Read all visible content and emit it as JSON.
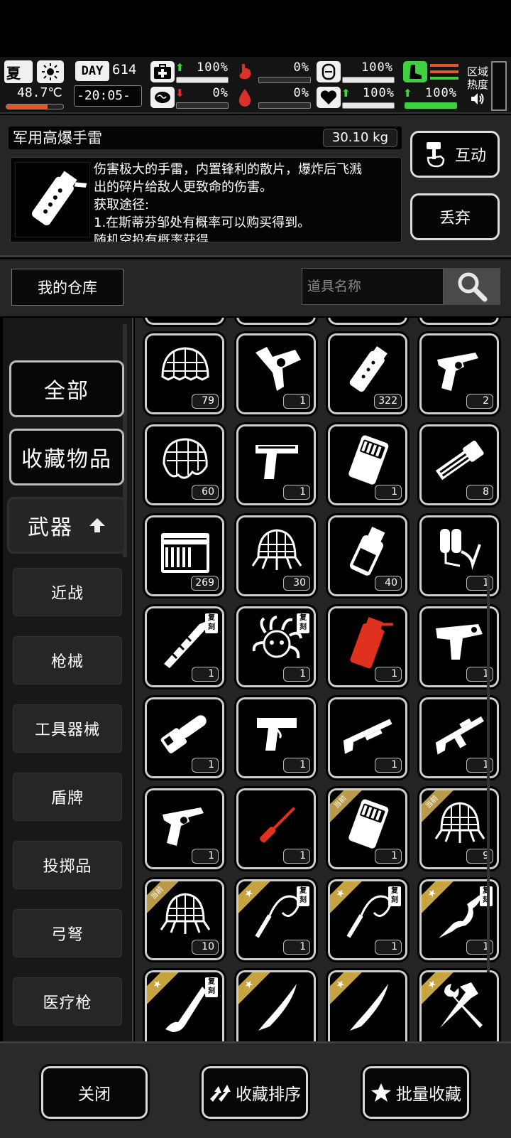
{
  "status": {
    "season": "夏",
    "temperature": "48.7℃",
    "day_label": "DAY",
    "day": "614",
    "time": "-20:05-",
    "health_pct": "100%",
    "hunger_pct": "0%",
    "stamina_pct": "100%",
    "infection_pct": "0%",
    "thirst_pct": "0%",
    "mood_pct": "100%",
    "speed_pct": "100%",
    "area_label": "区域",
    "heat_label": "热度",
    "colors": {
      "up_arrow": "#3fd13f",
      "down_arrow": "#e03030",
      "hunger_icon": "#d8322b"
    }
  },
  "item": {
    "name": "军用高爆手雷",
    "weight": "30.10 kg",
    "description_lines": [
      "伤害极大的手雷，内置锋利的散片，爆炸后飞溅",
      "出的碎片给敌人更致命的伤害。",
      "获取途径:",
      "1.在斯蒂芬邹处有概率可以购买得到。",
      "随机空投有概率获得"
    ],
    "interact_label": "互动",
    "discard_label": "丢弃"
  },
  "warehouse": {
    "title": "我的仓库",
    "search_placeholder": "道具名称"
  },
  "sidebar": {
    "categories": [
      {
        "label": "全部"
      },
      {
        "label": "收藏物品"
      },
      {
        "label": "武器"
      }
    ],
    "subcategories": [
      {
        "label": "近战"
      },
      {
        "label": "枪械"
      },
      {
        "label": "工具器械"
      },
      {
        "label": "盾牌"
      },
      {
        "label": "投掷品"
      },
      {
        "label": "弓弩"
      },
      {
        "label": "医疗枪"
      }
    ]
  },
  "grid": {
    "items": [
      {
        "icon": "net-helmet-icon",
        "qty": "79"
      },
      {
        "icon": "toy-gun-icon",
        "qty": "1"
      },
      {
        "icon": "grenade-canister-icon",
        "qty": "322"
      },
      {
        "icon": "revolver-icon",
        "qty": "2"
      },
      {
        "icon": "mesh-helmet-icon",
        "qty": "60"
      },
      {
        "icon": "desert-eagle-icon",
        "qty": "1"
      },
      {
        "icon": "ammo-case-icon",
        "qty": "1"
      },
      {
        "icon": "minigun-icon",
        "qty": "8"
      },
      {
        "icon": "ammo-crate-icon",
        "qty": "269"
      },
      {
        "icon": "spider-net-icon",
        "qty": "30"
      },
      {
        "icon": "flask-icon",
        "qty": "40"
      },
      {
        "icon": "flamethrower-icon",
        "qty": "1"
      },
      {
        "icon": "ornate-sword-icon",
        "qty": "1",
        "replica": "复刻"
      },
      {
        "icon": "medusa-icon",
        "qty": "1",
        "replica": "复刻"
      },
      {
        "icon": "red-grenade-icon",
        "qty": "1"
      },
      {
        "icon": "raygun-icon",
        "qty": "1"
      },
      {
        "icon": "chainsaw-icon",
        "qty": "1"
      },
      {
        "icon": "pistol-icon",
        "qty": "1"
      },
      {
        "icon": "shotgun-icon",
        "qty": "1"
      },
      {
        "icon": "assault-rifle-icon",
        "qty": "1"
      },
      {
        "icon": "revolver-icon",
        "qty": "1"
      },
      {
        "icon": "red-screwdriver-icon",
        "qty": "1"
      },
      {
        "icon": "ammo-case-icon",
        "qty": "1",
        "ribbon": "当前"
      },
      {
        "icon": "spider-net-icon",
        "qty": "9",
        "ribbon": "当前"
      },
      {
        "icon": "spider-net-icon",
        "qty": "10",
        "ribbon": "当前"
      },
      {
        "icon": "whip-icon",
        "qty": "1",
        "ribbon": "★",
        "replica": "复刻"
      },
      {
        "icon": "whip-icon",
        "qty": "1",
        "ribbon": "★",
        "replica": "复刻"
      },
      {
        "icon": "serpent-blade-icon",
        "qty": "1",
        "ribbon": "★",
        "replica": "复刻"
      },
      {
        "icon": "chain-blade-icon",
        "qty": "",
        "ribbon": "★",
        "replica": "复刻"
      },
      {
        "icon": "katana-icon",
        "qty": "",
        "ribbon": "★"
      },
      {
        "icon": "katana-icon",
        "qty": "",
        "ribbon": "★"
      },
      {
        "icon": "hammer-wrench-icon",
        "qty": "",
        "ribbon": "★"
      }
    ]
  },
  "bottom": {
    "close_label": "关闭",
    "sort_label": "收藏排序",
    "batch_label": "批量收藏"
  }
}
